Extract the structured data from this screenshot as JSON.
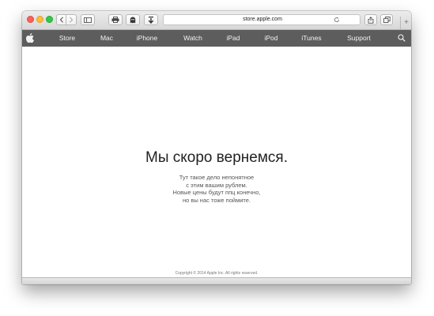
{
  "browser": {
    "address_url": "store.apple.com",
    "new_tab_glyph": "+",
    "toolbar_icons": [
      "back-icon",
      "forward-icon",
      "sidebar-icon",
      "print-icon",
      "ghostery-icon",
      "download-icon",
      "reload-icon",
      "share-icon",
      "tabs-icon"
    ]
  },
  "nav": {
    "items": [
      {
        "label": "Store"
      },
      {
        "label": "Mac"
      },
      {
        "label": "iPhone"
      },
      {
        "label": "Watch"
      },
      {
        "label": "iPad"
      },
      {
        "label": "iPod"
      },
      {
        "label": "iTunes"
      },
      {
        "label": "Support"
      }
    ],
    "icons": [
      "apple-logo-icon",
      "search-icon"
    ],
    "background_color": "#5d5d5d",
    "text_color": "#f2f2f2"
  },
  "main": {
    "headline": "Мы скоро вернемся.",
    "message_lines": [
      "Тут такое дело непонятное",
      "с этим вашим рублем.",
      "Новые цены будут ппц конечно,",
      "но вы нас тоже поймите."
    ],
    "copyright": "Copyright © 2014 Apple Inc. All rights reserved."
  }
}
